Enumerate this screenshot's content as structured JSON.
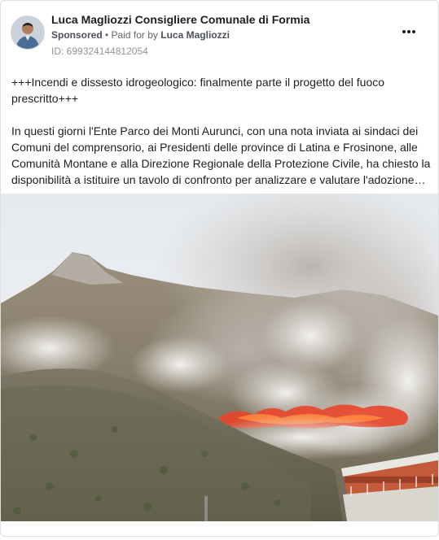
{
  "post": {
    "page_name": "Luca Magliozzi Consigliere Comunale di Formia",
    "sponsored_label": "Sponsored",
    "separator": " • ",
    "paid_for_by_prefix": "Paid for by",
    "payer_name": "Luca Magliozzi",
    "id_label": "ID: 699324144812054",
    "headline": "+++Incendi e dissesto idrogeologico: finalmente parte il progetto del fuoco prescritto+++",
    "body": "In questi giorni l'Ente Parco dei Monti Aurunci, con una nota inviata ai sindaci dei Comuni del comprensorio, ai Presidenti delle province di Latina e Frosinone, alle Comunità Montane e alla Direzione Regionale della Protezione Civile, ha chiesto la disponibilità a istituire un tavolo di confronto per analizzare e valutare l'adozione…"
  },
  "icons": {
    "avatar": "profile-photo",
    "more": "more-horizontal-icon"
  },
  "colors": {
    "sky": "#eef1f4",
    "smoke": "#d9d6d2",
    "fire": "#e8452a",
    "mountain": "#8d8678",
    "building": "#c45a3a"
  }
}
